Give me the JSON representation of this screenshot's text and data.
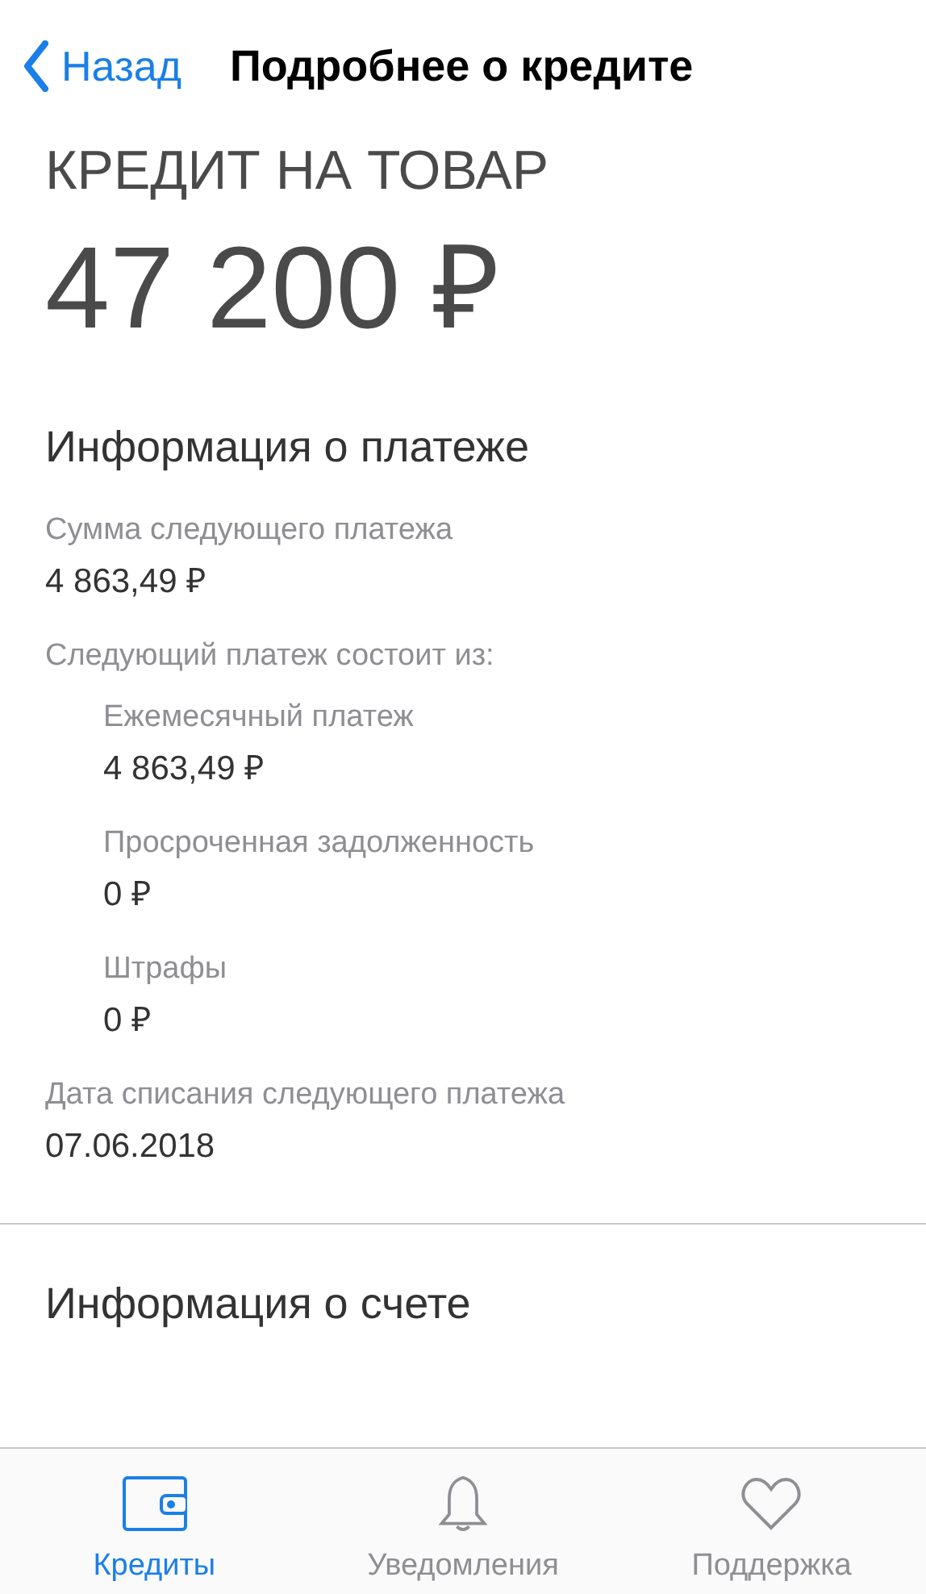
{
  "nav": {
    "back": "Назад",
    "title": "Подробнее о кредите"
  },
  "credit": {
    "type": "КРЕДИТ НА ТОВАР",
    "amount": "47 200 ₽"
  },
  "payment_info": {
    "heading": "Информация о платеже",
    "items": [
      {
        "label": "Сумма следующего платежа",
        "value": "4 863,49 ₽"
      },
      {
        "label": "Следующий платеж состоит из:",
        "children": [
          {
            "label": "Ежемесячный платеж",
            "value": "4 863,49 ₽"
          },
          {
            "label": "Просроченная задолженность",
            "value": "0 ₽"
          },
          {
            "label": "Штрафы",
            "value": "0 ₽"
          }
        ]
      },
      {
        "label": "Дата списания следующего платежа",
        "value": "07.06.2018"
      }
    ]
  },
  "account_info": {
    "heading": "Информация о счете"
  },
  "tabs": [
    {
      "label": "Кредиты",
      "selected": true
    },
    {
      "label": "Уведомления",
      "selected": false
    },
    {
      "label": "Поддержка",
      "selected": false
    }
  ]
}
